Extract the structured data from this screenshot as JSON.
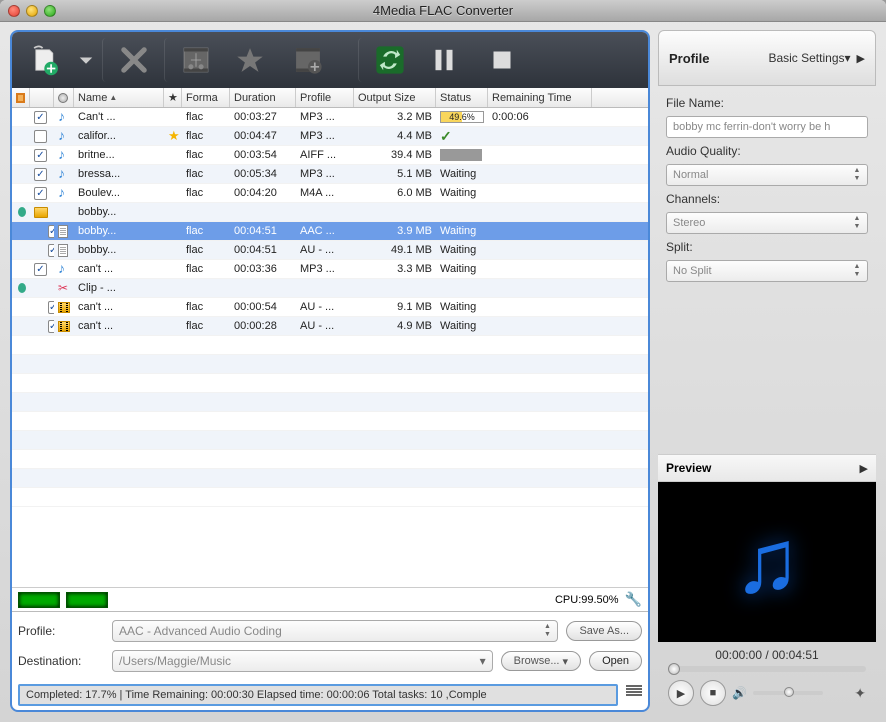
{
  "window": {
    "title": "4Media FLAC Converter"
  },
  "profile_panel": {
    "title": "Profile",
    "settings_dropdown": "Basic Settings",
    "fields": {
      "filename_label": "File Name:",
      "filename_value": "bobby mc ferrin-don't worry be h",
      "quality_label": "Audio Quality:",
      "quality_value": "Normal",
      "channels_label": "Channels:",
      "channels_value": "Stereo",
      "split_label": "Split:",
      "split_value": "No Split"
    }
  },
  "columns": {
    "name": "Name",
    "format": "Forma",
    "duration": "Duration",
    "profile": "Profile",
    "output": "Output Size",
    "status": "Status",
    "remaining": "Remaining Time"
  },
  "rows": [
    {
      "indent": 0,
      "chk": true,
      "icon": "note",
      "name": "Can't ...",
      "fmt": "flac",
      "dur": "00:03:27",
      "prof": "MP3 ...",
      "out": "3.2 MB",
      "status": "progress",
      "progress": "49.6%",
      "rem": "0:00:06"
    },
    {
      "indent": 0,
      "chk": false,
      "icon": "note",
      "name": "califor...",
      "star": true,
      "fmt": "flac",
      "dur": "00:04:47",
      "prof": "MP3 ...",
      "out": "4.4 MB",
      "status": "done"
    },
    {
      "indent": 0,
      "chk": true,
      "icon": "note",
      "name": "britne...",
      "fmt": "flac",
      "dur": "00:03:54",
      "prof": "AIFF ...",
      "out": "39.4 MB",
      "status": "gray"
    },
    {
      "indent": 0,
      "chk": true,
      "icon": "note",
      "name": "bressa...",
      "fmt": "flac",
      "dur": "00:05:34",
      "prof": "MP3 ...",
      "out": "5.1 MB",
      "status": "Waiting"
    },
    {
      "indent": 0,
      "chk": true,
      "icon": "note",
      "name": "Boulev...",
      "fmt": "flac",
      "dur": "00:04:20",
      "prof": "M4A ...",
      "out": "6.0 MB",
      "status": "Waiting"
    },
    {
      "indent": 0,
      "expand": true,
      "icon": "folder",
      "name": "bobby..."
    },
    {
      "indent": 1,
      "chk": true,
      "icon": "doc",
      "name": "bobby...",
      "fmt": "flac",
      "dur": "00:04:51",
      "prof": "AAC ...",
      "out": "3.9 MB",
      "status": "Waiting",
      "selected": true
    },
    {
      "indent": 1,
      "chk": true,
      "icon": "doc",
      "name": "bobby...",
      "fmt": "flac",
      "dur": "00:04:51",
      "prof": "AU - ...",
      "out": "49.1 MB",
      "status": "Waiting"
    },
    {
      "indent": 0,
      "chk": true,
      "icon": "note",
      "name": "can't ...",
      "fmt": "flac",
      "dur": "00:03:36",
      "prof": "MP3 ...",
      "out": "3.3 MB",
      "status": "Waiting"
    },
    {
      "indent": 0,
      "expand": true,
      "icon": "clip",
      "name": "Clip - ..."
    },
    {
      "indent": 1,
      "chk": true,
      "icon": "vclip",
      "name": "can't ...",
      "fmt": "flac",
      "dur": "00:00:54",
      "prof": "AU - ...",
      "out": "9.1 MB",
      "status": "Waiting"
    },
    {
      "indent": 1,
      "chk": true,
      "icon": "vclip",
      "name": "can't ...",
      "fmt": "flac",
      "dur": "00:00:28",
      "prof": "AU - ...",
      "out": "4.9 MB",
      "status": "Waiting"
    }
  ],
  "cpu": {
    "label": "CPU:99.50%"
  },
  "bottom": {
    "profile_label": "Profile:",
    "profile_value": "AAC - Advanced Audio Coding",
    "save_as": "Save As...",
    "dest_label": "Destination:",
    "dest_value": "/Users/Maggie/Music",
    "browse": "Browse...",
    "open": "Open",
    "status_text": "Completed: 17.7% | Time Remaining: 00:00:30 Elapsed time: 00:00:06 Total tasks: 10 ,Comple"
  },
  "preview": {
    "title": "Preview",
    "time": "00:00:00 / 00:04:51"
  }
}
